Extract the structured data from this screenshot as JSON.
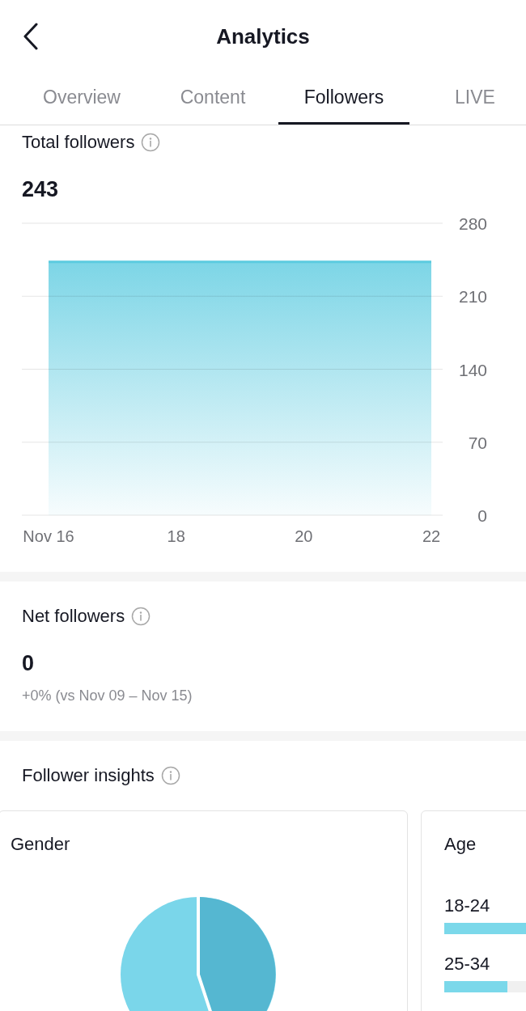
{
  "header": {
    "title": "Analytics"
  },
  "tabs": [
    {
      "label": "Overview",
      "selected": false
    },
    {
      "label": "Content",
      "selected": false
    },
    {
      "label": "Followers",
      "selected": true
    },
    {
      "label": "LIVE",
      "selected": false
    }
  ],
  "total_followers": {
    "title": "Total followers",
    "value": "243",
    "chart_data": {
      "type": "area",
      "categories": [
        "Nov 16",
        "18",
        "20",
        "22"
      ],
      "series": [
        {
          "color": "#5ccbe0",
          "values": [
            243,
            243,
            243,
            243
          ]
        }
      ],
      "ylim": [
        0,
        280
      ],
      "yticks": [
        0,
        70,
        140,
        210,
        280
      ],
      "grid": true
    }
  },
  "net_followers": {
    "title": "Net followers",
    "value": "0",
    "comparison": "+0% (vs Nov 09 – Nov 15)"
  },
  "follower_insights": {
    "title": "Follower insights",
    "gender": {
      "title": "Gender"
    },
    "age": {
      "title": "Age",
      "groups": [
        {
          "label": "18-24",
          "level": 0.55
        },
        {
          "label": "25-34",
          "level": 0.26
        }
      ]
    }
  }
}
